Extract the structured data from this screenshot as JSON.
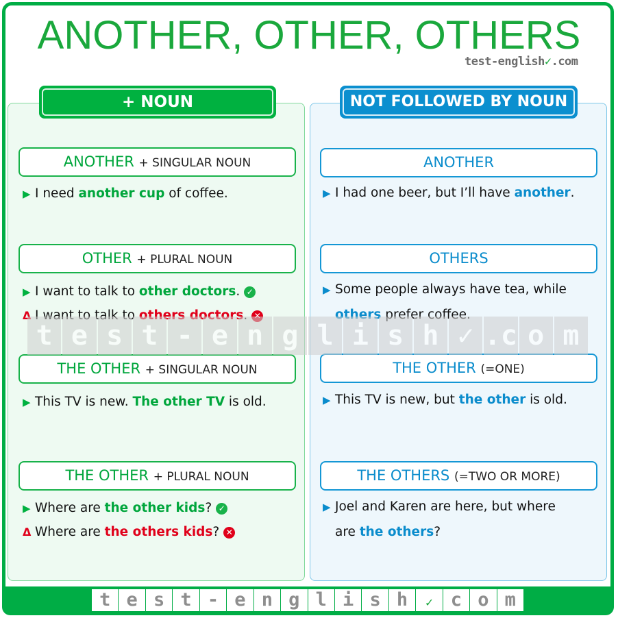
{
  "title": "ANOTHER, OTHER, OTHERS",
  "logo": {
    "left": "test-english",
    "check": "✓",
    "right": ".com"
  },
  "colors": {
    "green": "#00a63c",
    "blue": "#0a8ccc",
    "red": "#e0001a"
  },
  "left_header": "+ NOUN",
  "right_header": "NOT FOLLOWED BY NOUN",
  "left_rules": [
    {
      "key": "ANOTHER",
      "suffix": "+ SINGULAR NOUN"
    },
    {
      "key": "OTHER",
      "suffix": "+ PLURAL NOUN"
    },
    {
      "key": "THE OTHER",
      "suffix": "+ SINGULAR NOUN"
    },
    {
      "key": "THE OTHER",
      "suffix": "+ PLURAL NOUN"
    }
  ],
  "right_rules": [
    {
      "key": "ANOTHER",
      "suffix": ""
    },
    {
      "key": "OTHERS",
      "suffix": ""
    },
    {
      "key": "THE OTHER",
      "suffix": "(=ONE)"
    },
    {
      "key": "THE OTHERS",
      "suffix": "(=TWO OR MORE)"
    }
  ],
  "examples": [
    {
      "side": "l",
      "marker": "play",
      "mark": "",
      "parts": [
        {
          "t": "I need "
        },
        {
          "t": "another cup",
          "c": "g"
        },
        {
          "t": " of coffee."
        }
      ]
    },
    {
      "side": "l",
      "marker": "play",
      "mark": "correct",
      "parts": [
        {
          "t": "I want to talk to "
        },
        {
          "t": "other doctors",
          "c": "g"
        },
        {
          "t": "."
        }
      ]
    },
    {
      "side": "l",
      "marker": "delta",
      "mark": "wrong",
      "parts": [
        {
          "t": "I want to talk to "
        },
        {
          "t": "others doctors",
          "c": "r"
        },
        {
          "t": "."
        }
      ]
    },
    {
      "side": "l",
      "marker": "play",
      "mark": "",
      "parts": [
        {
          "t": "This TV is new. "
        },
        {
          "t": "The other TV",
          "c": "g"
        },
        {
          "t": " is old."
        }
      ]
    },
    {
      "side": "l",
      "marker": "play",
      "mark": "correct",
      "parts": [
        {
          "t": "Where are "
        },
        {
          "t": "the other kids",
          "c": "g"
        },
        {
          "t": "?"
        }
      ]
    },
    {
      "side": "l",
      "marker": "delta",
      "mark": "wrong",
      "parts": [
        {
          "t": "Where are "
        },
        {
          "t": "the others kids",
          "c": "r"
        },
        {
          "t": "?"
        }
      ]
    },
    {
      "side": "r",
      "marker": "play",
      "mark": "",
      "parts": [
        {
          "t": "I had one beer, but I’ll have "
        },
        {
          "t": "another",
          "c": "b"
        },
        {
          "t": "."
        }
      ]
    },
    {
      "side": "r",
      "marker": "play",
      "mark": "",
      "parts": [
        {
          "t": "Some people always have tea, while"
        }
      ]
    },
    {
      "side": "r",
      "marker": "none",
      "mark": "",
      "parts": [
        {
          "t": "others",
          "c": "b"
        },
        {
          "t": " prefer coffee."
        }
      ]
    },
    {
      "side": "r",
      "marker": "play",
      "mark": "",
      "parts": [
        {
          "t": "This TV is new, but "
        },
        {
          "t": "the other",
          "c": "b"
        },
        {
          "t": " is old."
        }
      ]
    },
    {
      "side": "r",
      "marker": "play",
      "mark": "",
      "parts": [
        {
          "t": "Joel and Karen are here, but where"
        }
      ]
    },
    {
      "side": "r",
      "marker": "none",
      "mark": "",
      "parts": [
        {
          "t": "are "
        },
        {
          "t": "the others",
          "c": "b"
        },
        {
          "t": "?"
        }
      ]
    }
  ],
  "watermark": [
    "t",
    "e",
    "s",
    "t",
    "-",
    "e",
    "n",
    "g",
    "l",
    "i",
    "s",
    "h",
    "✓",
    ".c",
    "o",
    "m"
  ],
  "footer_letters": [
    "t",
    "e",
    "s",
    "t",
    "-",
    "e",
    "n",
    "g",
    "l",
    "i",
    "s",
    "h",
    "✓",
    "c",
    "o",
    "m"
  ]
}
